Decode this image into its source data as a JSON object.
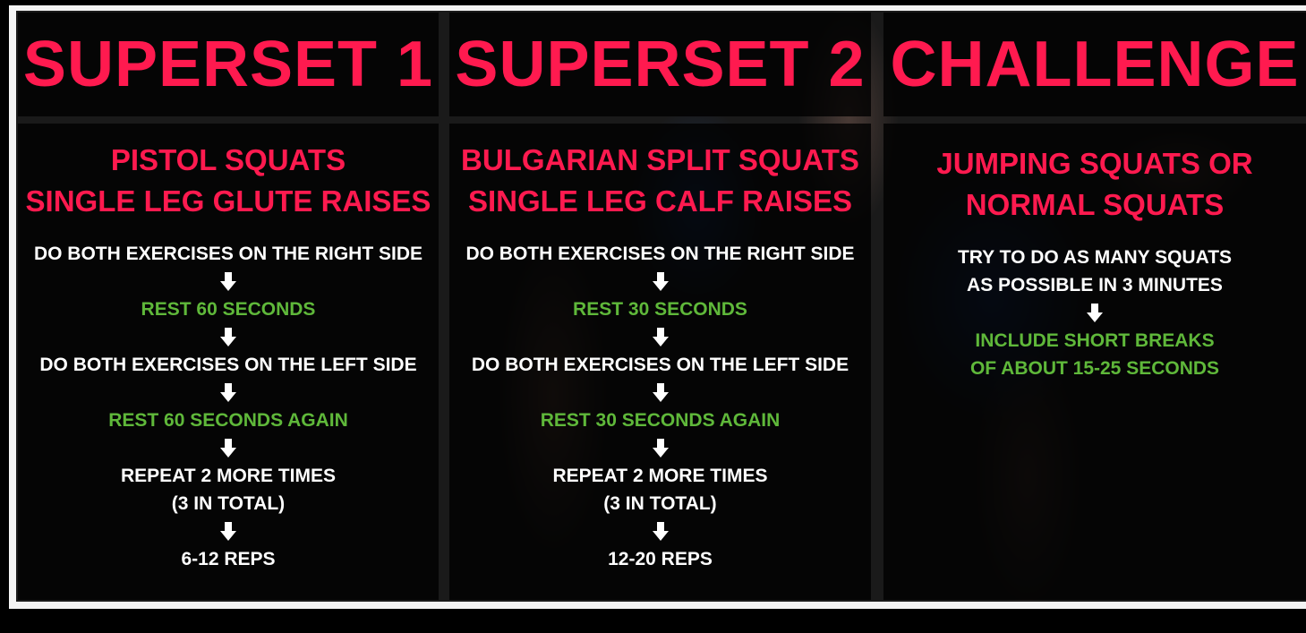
{
  "columns": [
    {
      "title": "SUPERSET 1",
      "heading_lines": [
        "PISTOL SQUATS",
        "SINGLE LEG GLUTE RAISES"
      ],
      "steps": [
        {
          "text": "DO BOTH EXERCISES ON THE RIGHT SIDE",
          "color": "white"
        },
        {
          "text": "REST 60 SECONDS",
          "color": "green"
        },
        {
          "text": "DO BOTH EXERCISES ON THE LEFT SIDE",
          "color": "white"
        },
        {
          "text": "REST 60 SECONDS AGAIN",
          "color": "green"
        },
        {
          "text": "REPEAT 2 MORE TIMES",
          "text2": "(3 IN TOTAL)",
          "color": "white"
        },
        {
          "text": "6-12 REPS",
          "color": "white"
        }
      ]
    },
    {
      "title": "SUPERSET 2",
      "heading_lines": [
        "BULGARIAN SPLIT SQUATS",
        "SINGLE LEG CALF RAISES"
      ],
      "steps": [
        {
          "text": "DO BOTH EXERCISES ON THE RIGHT SIDE",
          "color": "white"
        },
        {
          "text": "REST 30 SECONDS",
          "color": "green"
        },
        {
          "text": "DO BOTH EXERCISES ON THE LEFT SIDE",
          "color": "white"
        },
        {
          "text": "REST 30 SECONDS AGAIN",
          "color": "green"
        },
        {
          "text": "REPEAT 2 MORE TIMES",
          "text2": "(3 IN TOTAL)",
          "color": "white"
        },
        {
          "text": "12-20 REPS",
          "color": "white"
        }
      ]
    },
    {
      "title": "CHALLENGE",
      "heading_lines": [
        "JUMPING SQUATS OR",
        "NORMAL SQUATS"
      ],
      "steps": [
        {
          "text": "TRY TO DO AS MANY SQUATS",
          "text2": "AS POSSIBLE IN 3 MINUTES",
          "color": "white"
        },
        {
          "text": "INCLUDE SHORT BREAKS",
          "text2": "OF ABOUT 15-25 SECONDS",
          "color": "green"
        }
      ]
    }
  ],
  "colors": {
    "title": "#ff1a4f",
    "white_text": "#ffffff",
    "green_text": "#5fb83a",
    "frame": "#f4f4f4"
  },
  "icons": {
    "step_separator": "arrow-down-icon"
  }
}
